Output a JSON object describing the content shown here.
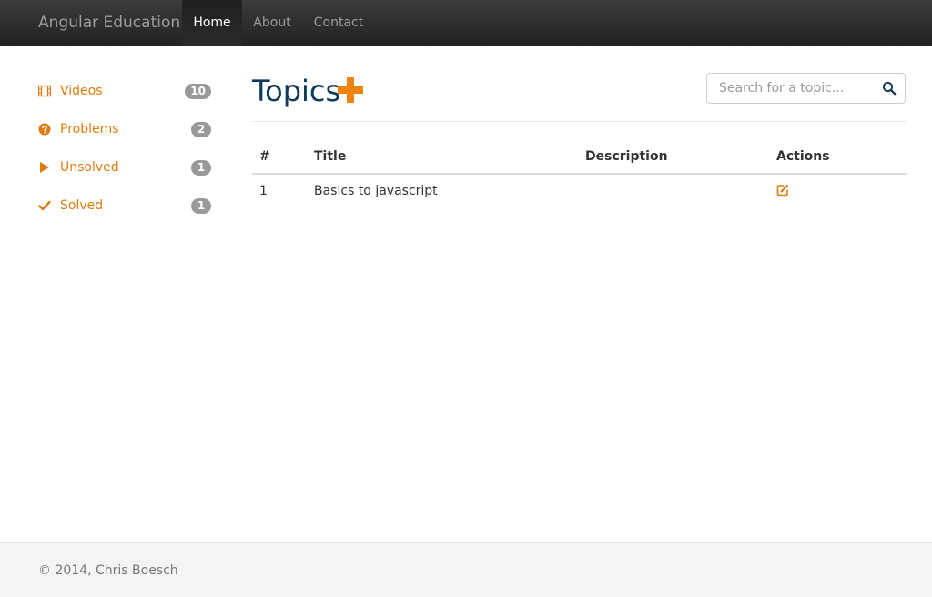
{
  "navbar": {
    "brand": "Angular Education",
    "items": [
      {
        "label": "Home",
        "active": true
      },
      {
        "label": "About",
        "active": false
      },
      {
        "label": "Contact",
        "active": false
      }
    ]
  },
  "sidebar": {
    "accent_color": "#e07a10",
    "items": [
      {
        "icon": "film-icon",
        "label": "Videos",
        "count": "10"
      },
      {
        "icon": "question-circle-icon",
        "label": "Problems",
        "count": "2"
      },
      {
        "icon": "play-icon",
        "label": "Unsolved",
        "count": "1"
      },
      {
        "icon": "checkmark-icon",
        "label": "Solved",
        "count": "1"
      }
    ]
  },
  "main": {
    "title": "Topics",
    "title_color": "#0b3a5c",
    "add_icon": "plus-icon",
    "search": {
      "placeholder": "Search for a topic...",
      "value": "",
      "icon": "search-icon"
    },
    "table": {
      "columns": [
        "#",
        "Title",
        "Description",
        "Actions"
      ],
      "rows": [
        {
          "num": "1",
          "title": "Basics to javascript",
          "description": "",
          "action_icon": "edit-icon"
        }
      ]
    }
  },
  "footer": {
    "text": "© 2014, Chris Boesch"
  }
}
